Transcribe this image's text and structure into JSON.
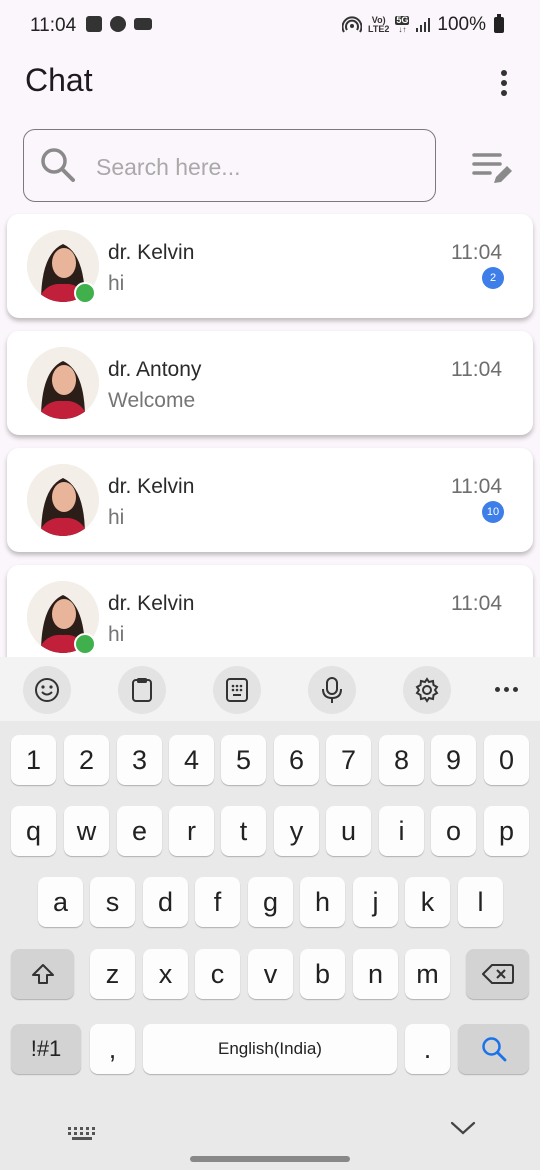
{
  "status_bar": {
    "time": "11:04",
    "network_top": "Vo)",
    "network_bottom": "LTE2",
    "net_5g": "5G",
    "battery": "100%",
    "left_icons": [
      "image-icon",
      "app-icon",
      "video-icon"
    ]
  },
  "app_bar": {
    "title": "Chat",
    "menu_icon": "more-vertical-icon"
  },
  "search": {
    "placeholder": "Search here...",
    "value": "",
    "icon": "search-icon",
    "filter_icon": "filter-edit-icon"
  },
  "chats": [
    {
      "name": "dr. Kelvin",
      "message": "hi",
      "time": "11:04",
      "unread": "2",
      "online": true
    },
    {
      "name": "dr. Antony",
      "message": "Welcome",
      "time": "11:04",
      "unread": "",
      "online": false
    },
    {
      "name": "dr. Kelvin",
      "message": "hi",
      "time": "11:04",
      "unread": "10",
      "online": false
    },
    {
      "name": "dr. Kelvin",
      "message": "hi",
      "time": "11:04",
      "unread": "",
      "online": true
    }
  ],
  "keyboard": {
    "toolbar": [
      "emoji-icon",
      "clipboard-icon",
      "keypad-icon",
      "microphone-icon",
      "settings-icon",
      "more-horizontal-icon"
    ],
    "row_numbers": [
      "1",
      "2",
      "3",
      "4",
      "5",
      "6",
      "7",
      "8",
      "9",
      "0"
    ],
    "row1": [
      "q",
      "w",
      "e",
      "r",
      "t",
      "y",
      "u",
      "i",
      "o",
      "p"
    ],
    "row2": [
      "a",
      "s",
      "d",
      "f",
      "g",
      "h",
      "j",
      "k",
      "l"
    ],
    "row3": [
      "z",
      "x",
      "c",
      "v",
      "b",
      "n",
      "m"
    ],
    "symbols_key": "!#1",
    "comma_key": ",",
    "space_label": "English(India)",
    "period_key": ".",
    "accent_color": "#1a73e8"
  }
}
